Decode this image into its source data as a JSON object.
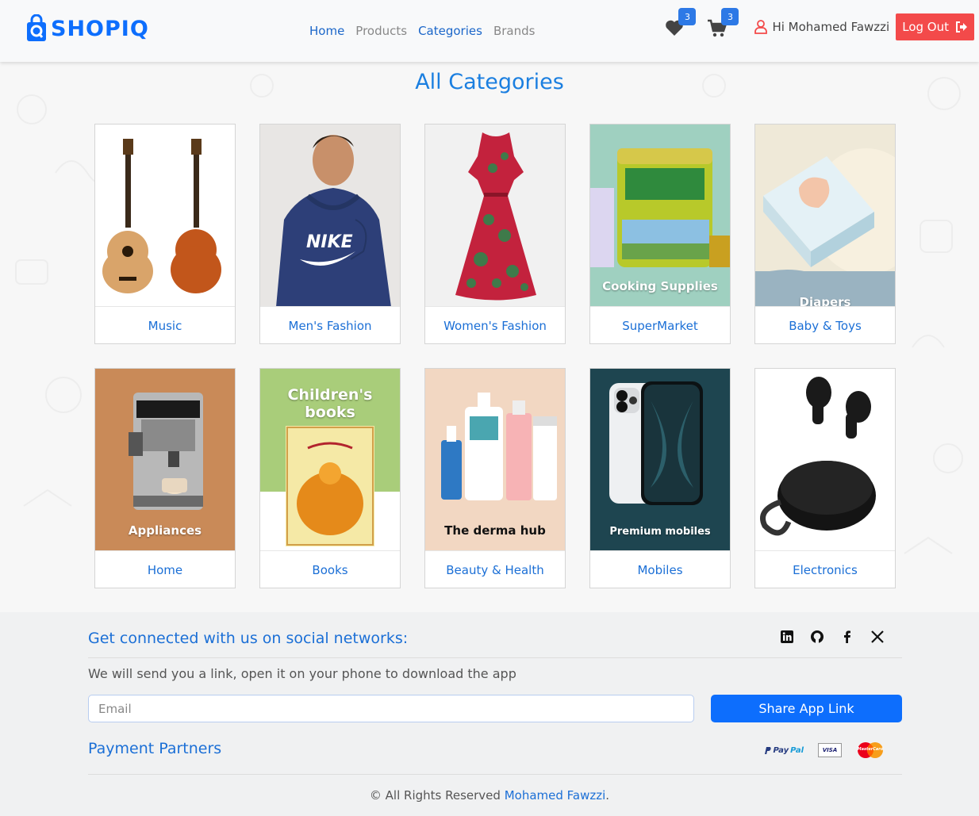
{
  "brand": {
    "name": "SHOPIQ",
    "accent": "#0d6efd"
  },
  "nav": {
    "links": [
      {
        "label": "Home",
        "active": true
      },
      {
        "label": "Products",
        "active": false
      },
      {
        "label": "Categories",
        "active": true
      },
      {
        "label": "Brands",
        "active": false
      }
    ],
    "wishlist_count": "3",
    "cart_count": "3",
    "greeting": "Hi Mohamed Fawzzi",
    "logout_label": "Log Out"
  },
  "main": {
    "title": "All Categories",
    "categories": [
      {
        "label": "Music",
        "image": "guitars",
        "caption": ""
      },
      {
        "label": "Men's Fashion",
        "image": "hoodie",
        "caption": ""
      },
      {
        "label": "Women's Fashion",
        "image": "dress",
        "caption": ""
      },
      {
        "label": "SuperMarket",
        "image": "milk-can",
        "caption": "Cooking Supplies"
      },
      {
        "label": "Baby & Toys",
        "image": "diapers-box",
        "caption": "Diapers"
      },
      {
        "label": "Home",
        "image": "coffee-machine",
        "caption": "Appliances"
      },
      {
        "label": "Books",
        "image": "childrens-book",
        "caption": "Children's books"
      },
      {
        "label": "Beauty & Health",
        "image": "skincare-bottles",
        "caption": "The derma hub"
      },
      {
        "label": "Mobiles",
        "image": "smartphone",
        "caption": "Premium mobiles"
      },
      {
        "label": "Electronics",
        "image": "earbuds",
        "caption": ""
      }
    ]
  },
  "footer": {
    "social_title": "Get connected with us on social networks:",
    "social_icons": [
      "linkedin-icon",
      "github-icon",
      "facebook-icon",
      "x-icon"
    ],
    "download_text": "We will send you a link, open it on your phone to download the app",
    "email_placeholder": "Email",
    "share_label": "Share App Link",
    "payment_title": "Payment Partners",
    "paypal_a": "Pay",
    "paypal_b": "Pal",
    "visa": "VISA",
    "mastercard": "MasterCard",
    "copyright_prefix": "© All Rights Reserved",
    "copyright_name": "Mohamed Fawzzi",
    "copyright_suffix": "."
  }
}
